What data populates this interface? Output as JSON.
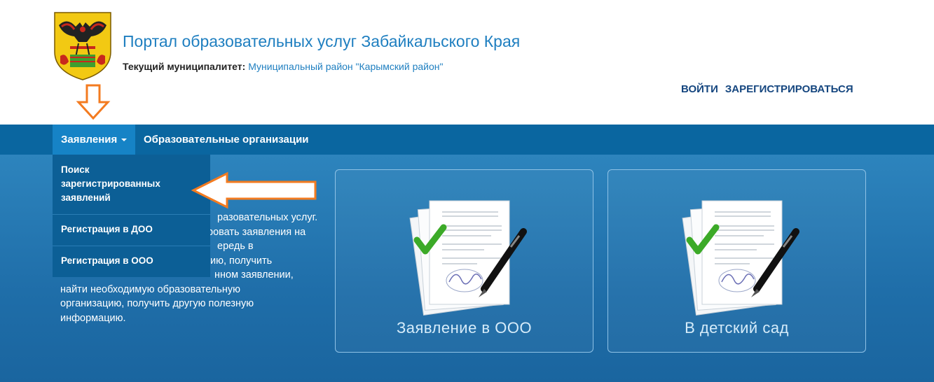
{
  "header": {
    "title": "Портал образовательных услуг Забайкальского Края",
    "municipality_label": "Текущий муниципалитет:",
    "municipality_value": "Муниципальный район \"Карымский район\"",
    "login": "ВОЙТИ",
    "register": "ЗАРЕГИСТРИРОВАТЬСЯ"
  },
  "nav": {
    "applications": "Заявления",
    "organizations": "Образовательные организации"
  },
  "dropdown": {
    "search_line1": "Поиск",
    "search_line2": "зарегистрированных",
    "search_line3": "заявлений",
    "reg_doo": "Регистрация в ДОО",
    "reg_ooo": "Регистрация в ООО"
  },
  "hero": {
    "title_fragment": "!",
    "text_lines": [
      "разовательных услуг.",
      "ровать заявления на",
      "ередь в",
      "ию, получить",
      "нном заявлении,",
      "найти необходимую образовательную",
      "организацию, получить другую полезную",
      "информацию."
    ]
  },
  "cards": {
    "school": "Заявление в ООО",
    "kindergarten": "В детский сад"
  },
  "colors": {
    "navbar": "#0a66a0",
    "nav_active": "#1683c6",
    "title_blue": "#1f7fc0",
    "auth_blue": "#15467f",
    "annotation_orange": "#f37b20"
  },
  "icons": {
    "emblem": "zabaikalsky-coat-of-arms",
    "card_image": "signed-document-with-checkmark-and-pen"
  }
}
